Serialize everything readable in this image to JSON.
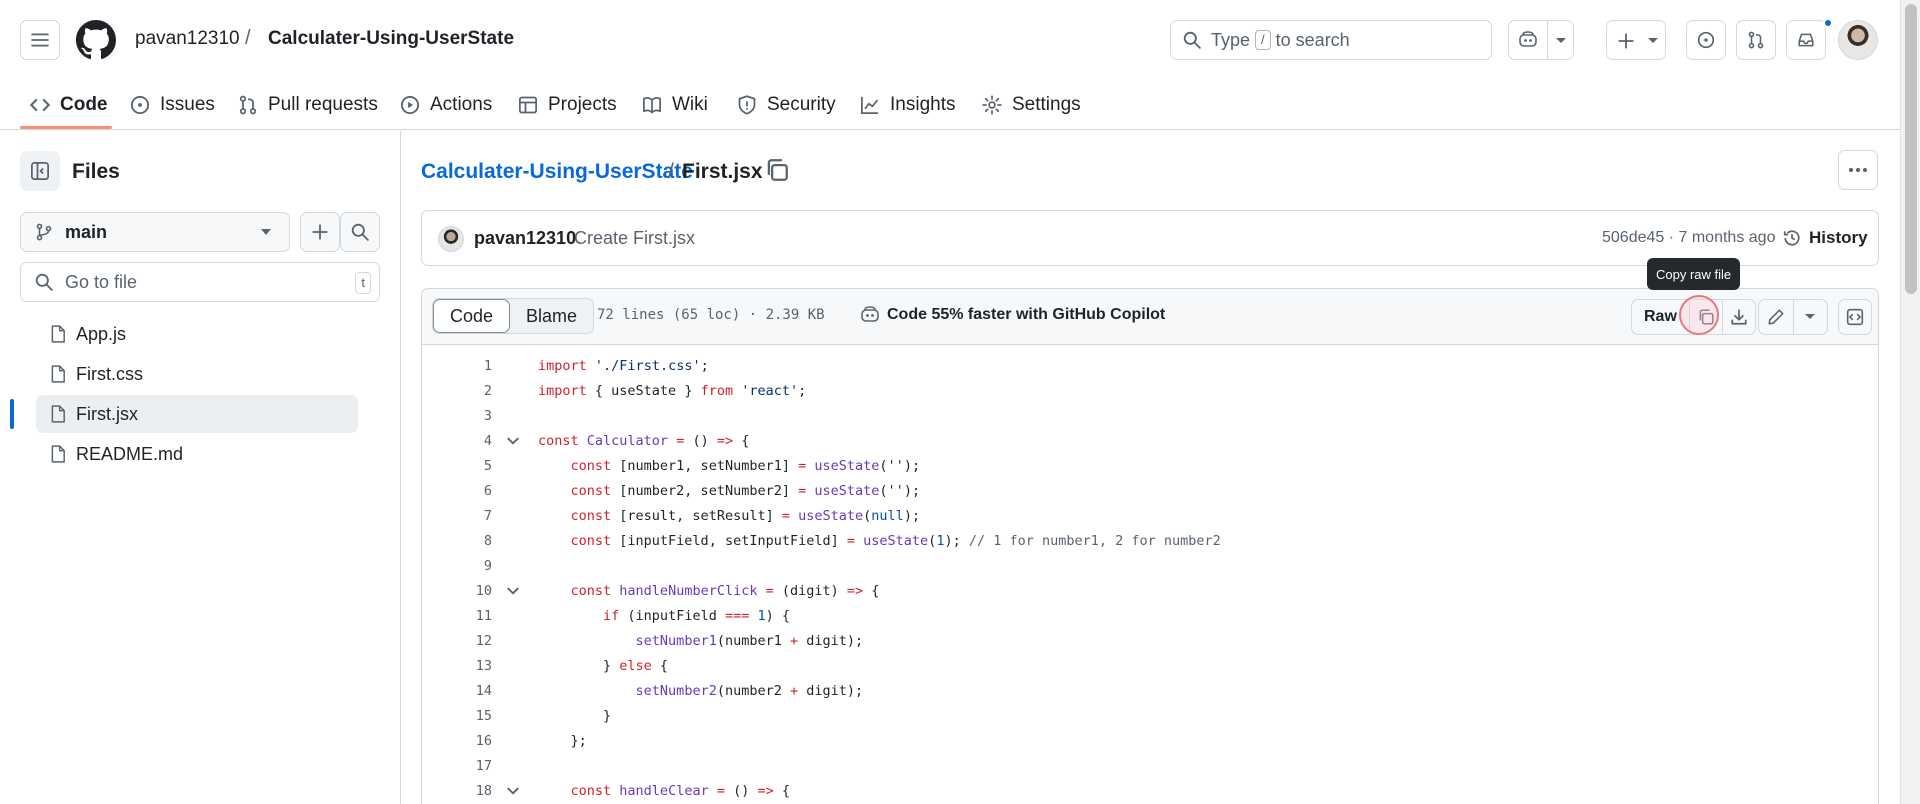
{
  "header": {
    "repo_owner": "pavan12310",
    "repo_separator": "/",
    "repo_name": "Calculater-Using-UserState",
    "search_prefix": "Type",
    "search_key": "/",
    "search_suffix": "to search"
  },
  "repo_nav": [
    {
      "label": "Code",
      "icon": "code-icon",
      "active": true
    },
    {
      "label": "Issues",
      "icon": "issue-icon"
    },
    {
      "label": "Pull requests",
      "icon": "pull-request-icon"
    },
    {
      "label": "Actions",
      "icon": "play-icon"
    },
    {
      "label": "Projects",
      "icon": "table-icon"
    },
    {
      "label": "Wiki",
      "icon": "book-icon"
    },
    {
      "label": "Security",
      "icon": "shield-icon"
    },
    {
      "label": "Insights",
      "icon": "graph-icon"
    },
    {
      "label": "Settings",
      "icon": "gear-icon"
    }
  ],
  "sidebar": {
    "title": "Files",
    "branch": "main",
    "goto_placeholder": "Go to file",
    "goto_shortcut": "t",
    "files": [
      {
        "name": "App.js"
      },
      {
        "name": "First.css"
      },
      {
        "name": "First.jsx",
        "active": true
      },
      {
        "name": "README.md"
      }
    ]
  },
  "breadcrumb": {
    "repo": "Calculater-Using-UserState",
    "separator": "/",
    "file": "First.jsx"
  },
  "commit": {
    "author": "pavan12310",
    "message": "Create First.jsx",
    "meta": "506de45 · 7 months ago",
    "history_label": "History"
  },
  "file_toolbar": {
    "code_tab": "Code",
    "blame_tab": "Blame",
    "info": "72 lines (65 loc) · 2.39 KB",
    "copilot": "Code 55% faster with GitHub Copilot",
    "raw_label": "Raw",
    "tooltip": "Copy raw file"
  },
  "code_lines": [
    {
      "n": "1",
      "html": "<span class=\"k\">import</span> <span class=\"s\">'./First.css'</span>;"
    },
    {
      "n": "2",
      "html": "<span class=\"k\">import</span> { useState } <span class=\"k\">from</span> <span class=\"s\">'react'</span>;"
    },
    {
      "n": "3",
      "html": ""
    },
    {
      "n": "4",
      "fold": true,
      "html": "<span class=\"k\">const</span> <span class=\"f\">Calculator</span> <span class=\"k\">=</span> () <span class=\"k\">=&gt;</span> {"
    },
    {
      "n": "5",
      "html": "    <span class=\"k\">const</span> [number1, setNumber1] <span class=\"k\">=</span> <span class=\"f\">useState</span>(<span class=\"s\">''</span>);"
    },
    {
      "n": "6",
      "html": "    <span class=\"k\">const</span> [number2, setNumber2] <span class=\"k\">=</span> <span class=\"f\">useState</span>(<span class=\"s\">''</span>);"
    },
    {
      "n": "7",
      "html": "    <span class=\"k\">const</span> [result, setResult] <span class=\"k\">=</span> <span class=\"f\">useState</span>(<span class=\"n\">null</span>);"
    },
    {
      "n": "8",
      "html": "    <span class=\"k\">const</span> [inputField, setInputField] <span class=\"k\">=</span> <span class=\"f\">useState</span>(<span class=\"n\">1</span>); <span class=\"c\">// 1 for number1, 2 for number2</span>"
    },
    {
      "n": "9",
      "html": ""
    },
    {
      "n": "10",
      "fold": true,
      "html": "    <span class=\"k\">const</span> <span class=\"f\">handleNumberClick</span> <span class=\"k\">=</span> (digit) <span class=\"k\">=&gt;</span> {"
    },
    {
      "n": "11",
      "html": "        <span class=\"k\">if</span> (inputField <span class=\"k\">===</span> <span class=\"n\">1</span>) {"
    },
    {
      "n": "12",
      "html": "            <span class=\"f\">setNumber1</span>(number1 <span class=\"k\">+</span> digit);"
    },
    {
      "n": "13",
      "html": "        } <span class=\"k\">else</span> {"
    },
    {
      "n": "14",
      "html": "            <span class=\"f\">setNumber2</span>(number2 <span class=\"k\">+</span> digit);"
    },
    {
      "n": "15",
      "html": "        }"
    },
    {
      "n": "16",
      "html": "    };"
    },
    {
      "n": "17",
      "html": ""
    },
    {
      "n": "18",
      "fold": true,
      "html": "    <span class=\"k\">const</span> <span class=\"f\">handleClear</span> <span class=\"k\">=</span> () <span class=\"k\">=&gt;</span> {"
    }
  ],
  "colors": {
    "accent": "#0969da",
    "nav_underline": "#fd8c73",
    "notification_dot": "#0969da"
  }
}
